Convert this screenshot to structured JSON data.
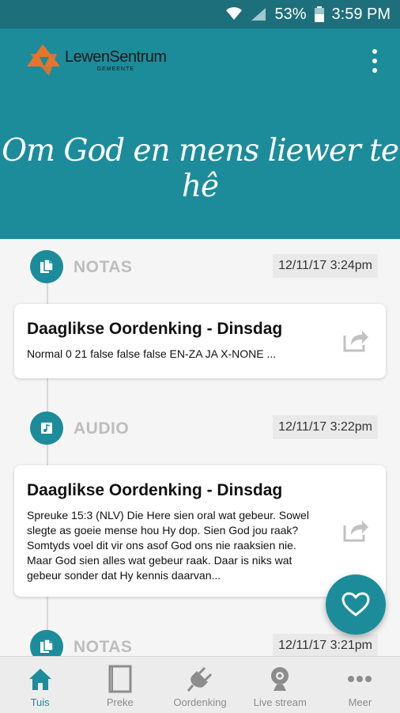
{
  "status_bar": {
    "battery": "53%",
    "time": "3:59 PM"
  },
  "header": {
    "logo_line1": "LewenSentrum",
    "logo_line2": "GEMEENTE",
    "tagline": "Om God en mens liewer te hê"
  },
  "feed": [
    {
      "type_label": "NOTAS",
      "icon": "document-icon",
      "timestamp": "12/11/17 3:24pm",
      "title": "Daaglikse Oordenking - Dinsdag",
      "body": "Normal 0 21 false false false EN-ZA JA X-NONE ..."
    },
    {
      "type_label": "AUDIO",
      "icon": "audio-file-icon",
      "timestamp": "12/11/17 3:22pm",
      "title": "Daaglikse Oordenking - Dinsdag",
      "body": "Spreuke 15:3 (NLV) Die Here sien oral wat gebeur. Sowel slegte as goeie mense hou Hy dop. Sien God jou raak? Somtyds voel dit vir ons asof God ons nie raaksien nie. Maar God sien alles wat gebeur raak. Daar is niks wat gebeur sonder dat Hy kennis daarvan..."
    },
    {
      "type_label": "NOTAS",
      "icon": "document-icon",
      "timestamp": "12/11/17 3:21pm"
    }
  ],
  "bottom_nav": [
    {
      "label": "Tuis",
      "icon": "home-icon",
      "active": true
    },
    {
      "label": "Preke",
      "icon": "book-icon",
      "active": false
    },
    {
      "label": "Oordenking",
      "icon": "plug-icon",
      "active": false
    },
    {
      "label": "Live stream",
      "icon": "webcam-icon",
      "active": false
    },
    {
      "label": "Meer",
      "icon": "more-dots-icon",
      "active": false
    }
  ],
  "colors": {
    "accent": "#1c8c9b",
    "status_bar": "#1d6f7b",
    "logo_orange": "#e8732a"
  }
}
